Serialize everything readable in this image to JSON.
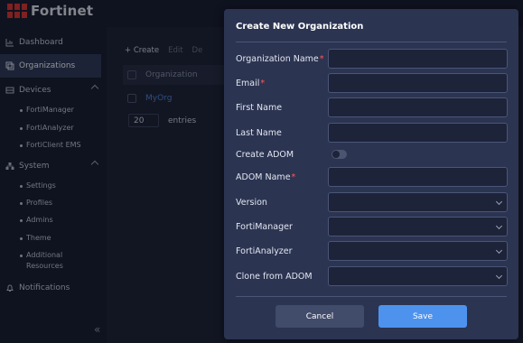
{
  "brand": {
    "name": "Fortinet"
  },
  "sidebar": {
    "items": [
      {
        "label": "Dashboard",
        "icon": "chart-icon"
      },
      {
        "label": "Organizations",
        "icon": "layers-icon",
        "active": true
      },
      {
        "label": "Devices",
        "icon": "device-icon",
        "expanded": true,
        "children": [
          "FortiManager",
          "FortiAnalyzer",
          "FortiClient EMS"
        ]
      },
      {
        "label": "System",
        "icon": "network-icon",
        "expanded": true,
        "children": [
          "Settings",
          "Profiles",
          "Admins",
          "Theme",
          "Additional Resources"
        ]
      },
      {
        "label": "Notifications",
        "icon": "bell-icon"
      }
    ],
    "collapse_glyph": "«"
  },
  "toolbar": {
    "create": "+ Create",
    "edit": "Edit",
    "delete": "De"
  },
  "table": {
    "header": "Organization",
    "rows": [
      {
        "name": "MyOrg"
      }
    ],
    "page_size": "20",
    "entries_label": "entries"
  },
  "modal": {
    "title": "Create New Organization",
    "fields": {
      "org_name": "Organization Name",
      "email": "Email",
      "first_name": "First Name",
      "last_name": "Last Name",
      "create_adom": "Create ADOM",
      "adom_name": "ADOM Name",
      "version": "Version",
      "fortimanager": "FortiManager",
      "fortianalyzer": "FortiAnalyzer",
      "clone_adom": "Clone from ADOM"
    },
    "required_mark": "*",
    "create_adom_enabled": false,
    "cancel": "Cancel",
    "save": "Save"
  },
  "colors": {
    "accent": "#4d93ee",
    "brand": "#e0322f",
    "required": "#ff5a5a"
  }
}
